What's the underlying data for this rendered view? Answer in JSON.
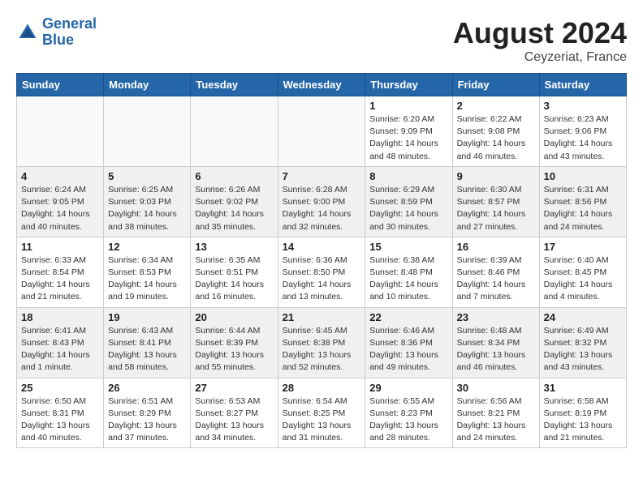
{
  "header": {
    "logo_line1": "General",
    "logo_line2": "Blue",
    "month_year": "August 2024",
    "location": "Ceyzeriat, France"
  },
  "weekdays": [
    "Sunday",
    "Monday",
    "Tuesday",
    "Wednesday",
    "Thursday",
    "Friday",
    "Saturday"
  ],
  "weeks": [
    [
      {
        "day": "",
        "detail": ""
      },
      {
        "day": "",
        "detail": ""
      },
      {
        "day": "",
        "detail": ""
      },
      {
        "day": "",
        "detail": ""
      },
      {
        "day": "1",
        "detail": "Sunrise: 6:20 AM\nSunset: 9:09 PM\nDaylight: 14 hours\nand 48 minutes."
      },
      {
        "day": "2",
        "detail": "Sunrise: 6:22 AM\nSunset: 9:08 PM\nDaylight: 14 hours\nand 46 minutes."
      },
      {
        "day": "3",
        "detail": "Sunrise: 6:23 AM\nSunset: 9:06 PM\nDaylight: 14 hours\nand 43 minutes."
      }
    ],
    [
      {
        "day": "4",
        "detail": "Sunrise: 6:24 AM\nSunset: 9:05 PM\nDaylight: 14 hours\nand 40 minutes."
      },
      {
        "day": "5",
        "detail": "Sunrise: 6:25 AM\nSunset: 9:03 PM\nDaylight: 14 hours\nand 38 minutes."
      },
      {
        "day": "6",
        "detail": "Sunrise: 6:26 AM\nSunset: 9:02 PM\nDaylight: 14 hours\nand 35 minutes."
      },
      {
        "day": "7",
        "detail": "Sunrise: 6:28 AM\nSunset: 9:00 PM\nDaylight: 14 hours\nand 32 minutes."
      },
      {
        "day": "8",
        "detail": "Sunrise: 6:29 AM\nSunset: 8:59 PM\nDaylight: 14 hours\nand 30 minutes."
      },
      {
        "day": "9",
        "detail": "Sunrise: 6:30 AM\nSunset: 8:57 PM\nDaylight: 14 hours\nand 27 minutes."
      },
      {
        "day": "10",
        "detail": "Sunrise: 6:31 AM\nSunset: 8:56 PM\nDaylight: 14 hours\nand 24 minutes."
      }
    ],
    [
      {
        "day": "11",
        "detail": "Sunrise: 6:33 AM\nSunset: 8:54 PM\nDaylight: 14 hours\nand 21 minutes."
      },
      {
        "day": "12",
        "detail": "Sunrise: 6:34 AM\nSunset: 8:53 PM\nDaylight: 14 hours\nand 19 minutes."
      },
      {
        "day": "13",
        "detail": "Sunrise: 6:35 AM\nSunset: 8:51 PM\nDaylight: 14 hours\nand 16 minutes."
      },
      {
        "day": "14",
        "detail": "Sunrise: 6:36 AM\nSunset: 8:50 PM\nDaylight: 14 hours\nand 13 minutes."
      },
      {
        "day": "15",
        "detail": "Sunrise: 6:38 AM\nSunset: 8:48 PM\nDaylight: 14 hours\nand 10 minutes."
      },
      {
        "day": "16",
        "detail": "Sunrise: 6:39 AM\nSunset: 8:46 PM\nDaylight: 14 hours\nand 7 minutes."
      },
      {
        "day": "17",
        "detail": "Sunrise: 6:40 AM\nSunset: 8:45 PM\nDaylight: 14 hours\nand 4 minutes."
      }
    ],
    [
      {
        "day": "18",
        "detail": "Sunrise: 6:41 AM\nSunset: 8:43 PM\nDaylight: 14 hours\nand 1 minute."
      },
      {
        "day": "19",
        "detail": "Sunrise: 6:43 AM\nSunset: 8:41 PM\nDaylight: 13 hours\nand 58 minutes."
      },
      {
        "day": "20",
        "detail": "Sunrise: 6:44 AM\nSunset: 8:39 PM\nDaylight: 13 hours\nand 55 minutes."
      },
      {
        "day": "21",
        "detail": "Sunrise: 6:45 AM\nSunset: 8:38 PM\nDaylight: 13 hours\nand 52 minutes."
      },
      {
        "day": "22",
        "detail": "Sunrise: 6:46 AM\nSunset: 8:36 PM\nDaylight: 13 hours\nand 49 minutes."
      },
      {
        "day": "23",
        "detail": "Sunrise: 6:48 AM\nSunset: 8:34 PM\nDaylight: 13 hours\nand 46 minutes."
      },
      {
        "day": "24",
        "detail": "Sunrise: 6:49 AM\nSunset: 8:32 PM\nDaylight: 13 hours\nand 43 minutes."
      }
    ],
    [
      {
        "day": "25",
        "detail": "Sunrise: 6:50 AM\nSunset: 8:31 PM\nDaylight: 13 hours\nand 40 minutes."
      },
      {
        "day": "26",
        "detail": "Sunrise: 6:51 AM\nSunset: 8:29 PM\nDaylight: 13 hours\nand 37 minutes."
      },
      {
        "day": "27",
        "detail": "Sunrise: 6:53 AM\nSunset: 8:27 PM\nDaylight: 13 hours\nand 34 minutes."
      },
      {
        "day": "28",
        "detail": "Sunrise: 6:54 AM\nSunset: 8:25 PM\nDaylight: 13 hours\nand 31 minutes."
      },
      {
        "day": "29",
        "detail": "Sunrise: 6:55 AM\nSunset: 8:23 PM\nDaylight: 13 hours\nand 28 minutes."
      },
      {
        "day": "30",
        "detail": "Sunrise: 6:56 AM\nSunset: 8:21 PM\nDaylight: 13 hours\nand 24 minutes."
      },
      {
        "day": "31",
        "detail": "Sunrise: 6:58 AM\nSunset: 8:19 PM\nDaylight: 13 hours\nand 21 minutes."
      }
    ]
  ]
}
